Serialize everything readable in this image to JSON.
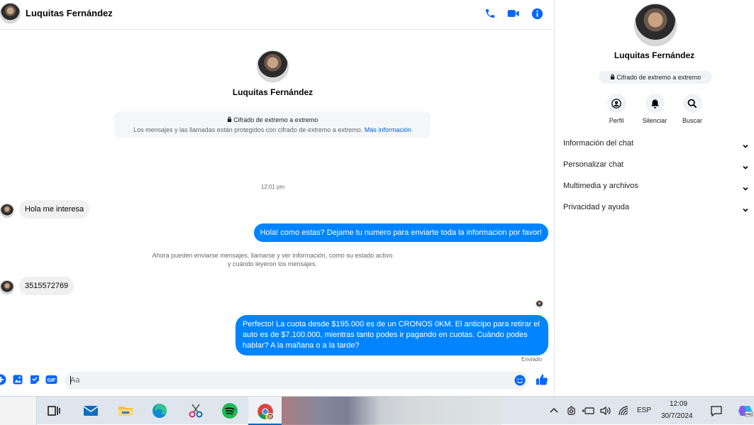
{
  "header": {
    "contact_name": "Luquitas Fernández"
  },
  "intro": {
    "contact_name": "Luquitas Fernández",
    "e2e_title": "Cifrado de extremo a extremo",
    "e2e_desc": "Los mensajes y las llamadas están protegidos con cifrado de extremo a extremo.",
    "e2e_link": "Más información"
  },
  "conversation": {
    "timestamp": "12:01 pm",
    "messages": [
      {
        "dir": "in",
        "text": "Hola me interesa"
      },
      {
        "dir": "out",
        "text": "Hola! como estas? Dejame tu numero para enviarte toda la informacion por favor!"
      },
      {
        "dir": "system",
        "text": "Ahora pueden enviarse mensajes, llamarse y ver información, como su estado activo y cuándo leyeron los mensajes."
      },
      {
        "dir": "in",
        "text": "3515572769"
      },
      {
        "dir": "out",
        "text": "Perfecto! La cuota desde $195.000 es de un CRONOS 0KM. El anticipo para retirar el auto es de $7.100.000, mientras tanto podes ir pagando en cuotas. Cuándo podes hablar? A la mañana o a la tarde?"
      }
    ],
    "delivery_status": "Enviado"
  },
  "composer": {
    "placeholder": "Aa",
    "gif_label": "GIF"
  },
  "side_panel": {
    "contact_name": "Luquitas Fernández",
    "e2e_badge": "Cifrado de extremo a extremo",
    "actions": [
      {
        "label": "Perfil",
        "icon": "profile-icon"
      },
      {
        "label": "Silenciar",
        "icon": "bell-icon"
      },
      {
        "label": "Buscar",
        "icon": "search-icon"
      }
    ],
    "sections": [
      {
        "label": "Información del chat"
      },
      {
        "label": "Personalizar chat"
      },
      {
        "label": "Multimedia y archivos"
      },
      {
        "label": "Privacidad y ayuda"
      }
    ]
  },
  "taskbar": {
    "language": "ESP",
    "time": "12:09",
    "date": "30/7/2024",
    "chrome_badge": "M",
    "copilot_badge": "PRE"
  },
  "colors": {
    "messenger_blue": "#0084ff",
    "accent_blue": "#0866ff",
    "bubble_gray": "#f0f0f0"
  }
}
